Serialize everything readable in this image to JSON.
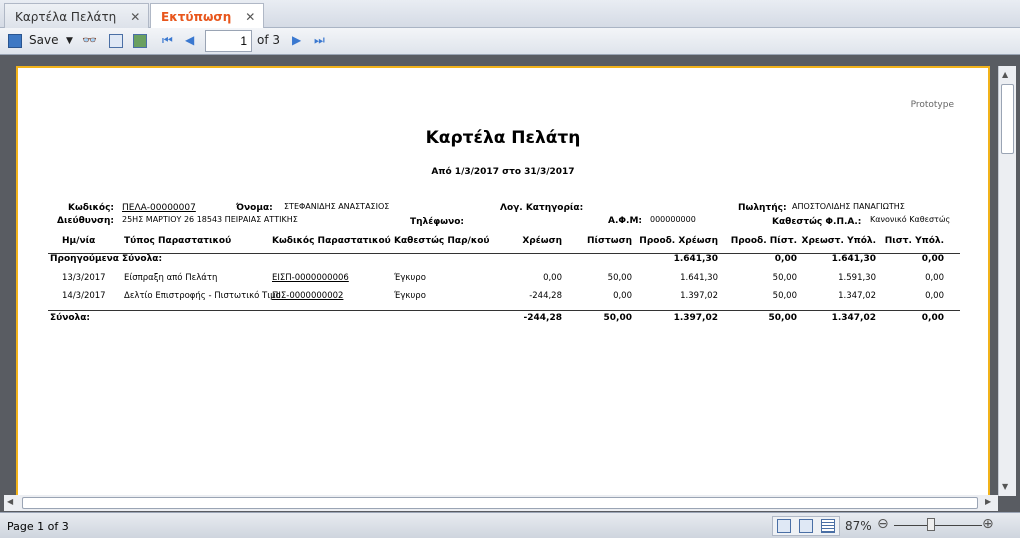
{
  "tabs": [
    {
      "label": "Καρτέλα Πελάτη",
      "active": false
    },
    {
      "label": "Εκτύπωση",
      "active": true
    }
  ],
  "toolbar": {
    "save_label": "Save",
    "current_page": "1",
    "of_pages": "of 3"
  },
  "report": {
    "watermark": "Prototype",
    "title": "Καρτέλα Πελάτη",
    "period": "Από 1/3/2017 στο 31/3/2017",
    "code_label": "Κωδικός:",
    "code_value": "ΠΕΛΑ-00000007",
    "name_label": "Όνομα:",
    "name_value": "ΣΤΕΦΑΝΙΔΗΣ ΑΝΑΣΤΑΣΙΟΣ",
    "category_label": "Λογ. Κατηγορία:",
    "seller_label": "Πωλητής:",
    "seller_value": "ΑΠΟΣΤΟΛΙΔΗΣ ΠΑΝΑΓΙΩΤΗΣ",
    "address_label": "Διεύθυνση:",
    "address_value": "25ΗΣ ΜΑΡΤΙΟΥ 26 18543 ΠΕΙΡΑΙΑΣ ΑΤΤΙΚΗΣ",
    "phone_label": "Τηλέφωνο:",
    "afm_label": "Α.Φ.Μ:",
    "afm_value": "000000000",
    "vat_label": "Καθεστώς Φ.Π.Α.:",
    "vat_value": "Κανονικό Καθεστώς",
    "columns": [
      "Ημ/νία",
      "Τύπος Παραστατικού",
      "Κωδικός Παραστατικού",
      "Καθεστώς Παρ/κού",
      "Χρέωση",
      "Πίστωση",
      "Προοδ. Χρέωση",
      "Προοδ. Πίστ.",
      "Χρεωστ. Υπόλ.",
      "Πιστ. Υπόλ."
    ],
    "previous": {
      "label": "Προηγούμενα Σύνολα:",
      "prog_debit": "1.641,30",
      "prog_credit": "0,00",
      "debit_bal": "1.641,30",
      "credit_bal": "0,00"
    },
    "rows": [
      [
        "13/3/2017",
        "Είσπραξη από Πελάτη",
        "ΕΙΣΠ-0000000006",
        "Έγκυρο",
        "0,00",
        "50,00",
        "1.641,30",
        "50,00",
        "1.591,30",
        "0,00"
      ],
      [
        "14/3/2017",
        "Δελτίο Επιστροφής - Πιστωτικό Τιμο",
        "ΠΙΣ-0000000002",
        "Έγκυρο",
        "-244,28",
        "0,00",
        "1.397,02",
        "50,00",
        "1.347,02",
        "0,00"
      ]
    ],
    "totals": {
      "label": "Σύνολα:",
      "values": [
        "-244,28",
        "50,00",
        "1.397,02",
        "50,00",
        "1.347,02",
        "0,00"
      ]
    }
  },
  "status": {
    "page_text": "Page 1 of 3",
    "zoom": "87%",
    "zoom_level_percent": 87
  },
  "colors": {
    "accent": "#e8561c",
    "page_border": "#f2b31a"
  }
}
